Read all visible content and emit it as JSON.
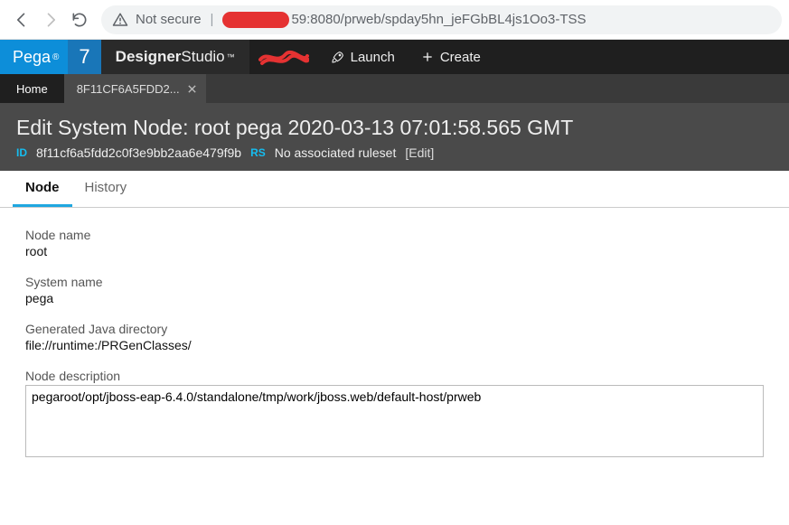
{
  "browser": {
    "not_secure": "Not secure",
    "url_suffix": "59:8080/prweb/spday5hn_jeFGbBL4js1Oo3-TSS"
  },
  "pega": {
    "brand": "Pega",
    "version": "7",
    "designer": "Designer",
    "studio": "Studio",
    "tm": "™",
    "launch": "Launch",
    "create": "Create"
  },
  "tabs": {
    "home": "Home",
    "open_tab": "8F11CF6A5FDD2..."
  },
  "header": {
    "title": "Edit System Node: root pega 2020-03-13 07:01:58.565 GMT",
    "id_label": "ID",
    "id_value": "8f11cf6a5fdd2c0f3e9bb2aa6e479f9b",
    "rs_label": "RS",
    "rs_value": "No associated ruleset",
    "edit": "[Edit]"
  },
  "section_tabs": {
    "node": "Node",
    "history": "History"
  },
  "fields": {
    "node_name_label": "Node name",
    "node_name_value": "root",
    "system_name_label": "System name",
    "system_name_value": "pega",
    "gen_dir_label": "Generated Java directory",
    "gen_dir_value": "file://runtime:/PRGenClasses/",
    "desc_label": "Node description",
    "desc_value": "pegaroot/opt/jboss-eap-6.4.0/standalone/tmp/work/jboss.web/default-host/prweb"
  }
}
